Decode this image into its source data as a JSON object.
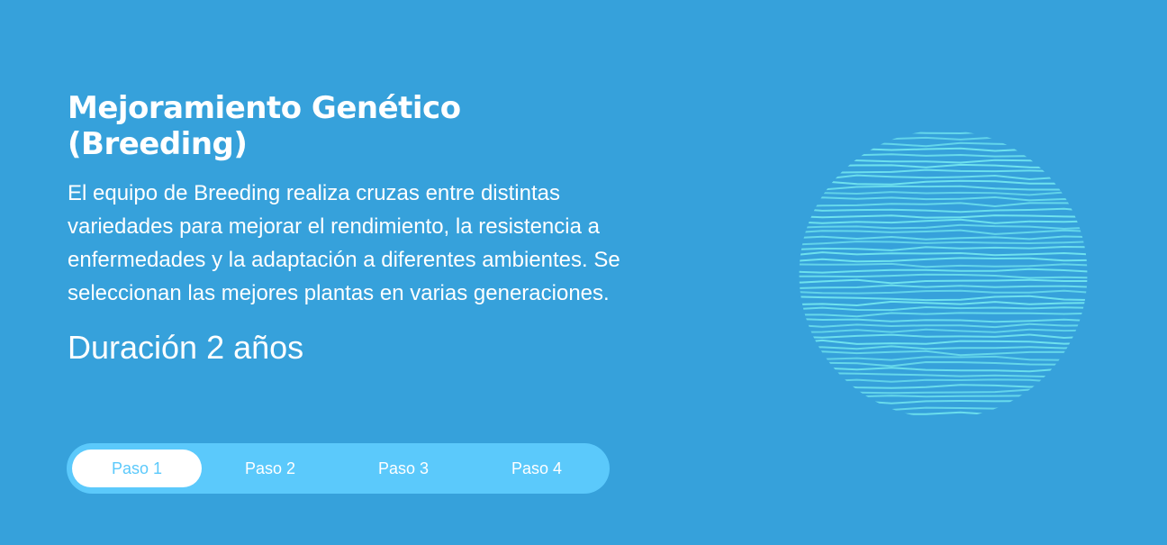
{
  "section": {
    "title": "Mejoramiento Genético (Breeding)",
    "description": "El equipo de Breeding realiza cruzas entre distintas variedades para mejorar el rendimiento, la resistencia a enfermedades y la adaptación a diferentes ambientes. Se seleccionan las mejores plantas en varias generaciones.",
    "duration": "Duración 2 años"
  },
  "steps": {
    "items": [
      {
        "label": "Paso 1"
      },
      {
        "label": "Paso 2"
      },
      {
        "label": "Paso 3"
      },
      {
        "label": "Paso 4"
      }
    ],
    "active": "Paso 1"
  },
  "colors": {
    "background": "#36a1db",
    "step_track": "#5bc9fb",
    "wave_lines": "#6fe3ee"
  },
  "illustration": {
    "icon": "wavy-lines-sphere-icon"
  }
}
